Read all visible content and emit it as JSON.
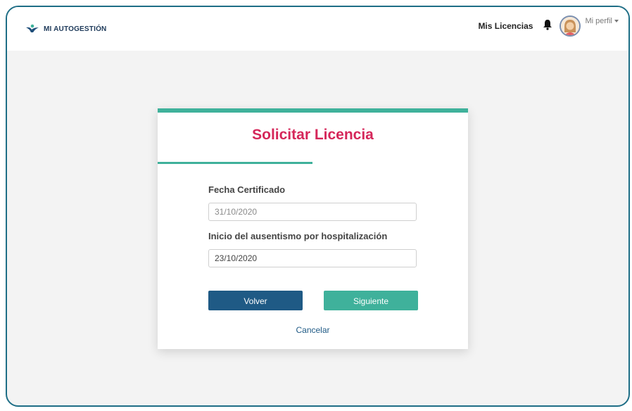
{
  "header": {
    "logo_text": "MI AUTOGESTIÓN",
    "nav_link": "Mis Licencias",
    "profile_label": "Mi perfil"
  },
  "card": {
    "title": "Solicitar Licencia",
    "fields": [
      {
        "label": "Fecha Certificado",
        "value": "31/10/2020"
      },
      {
        "label": "Inicio del ausentismo por hospitalización",
        "value": "23/10/2020"
      }
    ],
    "back_label": "Volver",
    "next_label": "Siguiente",
    "cancel_label": "Cancelar"
  },
  "colors": {
    "accent_teal": "#3fb19b",
    "title_red": "#d5275a",
    "primary_blue": "#1f5a85"
  },
  "icons": [
    "logo-icon",
    "bell-icon",
    "avatar",
    "caret-down-icon"
  ]
}
